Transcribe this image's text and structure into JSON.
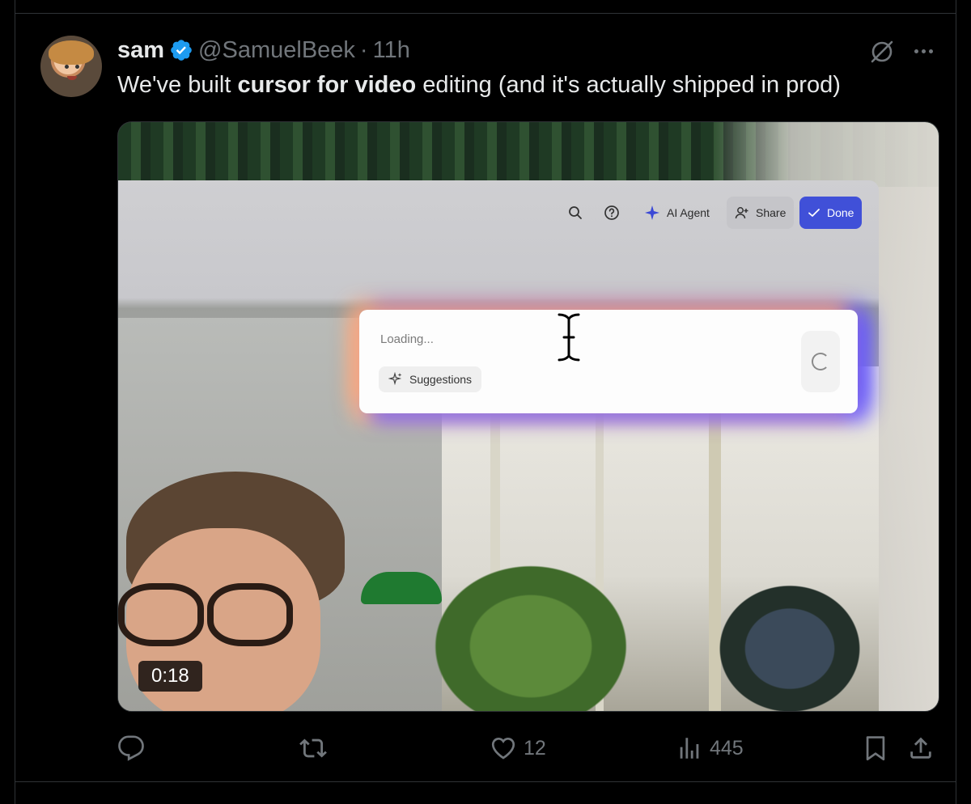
{
  "tweet": {
    "author_name": "sam",
    "handle": "@SamuelBeek",
    "separator": "·",
    "time": "11h",
    "text_before": "We've built ",
    "text_bold": "cursor for video",
    "text_after": " editing (and it's actually shipped in prod)"
  },
  "video": {
    "duration": "0:18",
    "app": {
      "toolbar": {
        "ai_agent_label": "AI Agent",
        "share_label": "Share",
        "done_label": "Done"
      },
      "ai_panel": {
        "status_text": "Loading...",
        "suggestions_label": "Suggestions"
      }
    }
  },
  "actions": {
    "like_count": "12",
    "view_count": "445"
  },
  "colors": {
    "background": "#000000",
    "text": "#e7e9ea",
    "muted": "#71767b",
    "verified": "#1d9bf0",
    "done_button": "#4050d8"
  }
}
